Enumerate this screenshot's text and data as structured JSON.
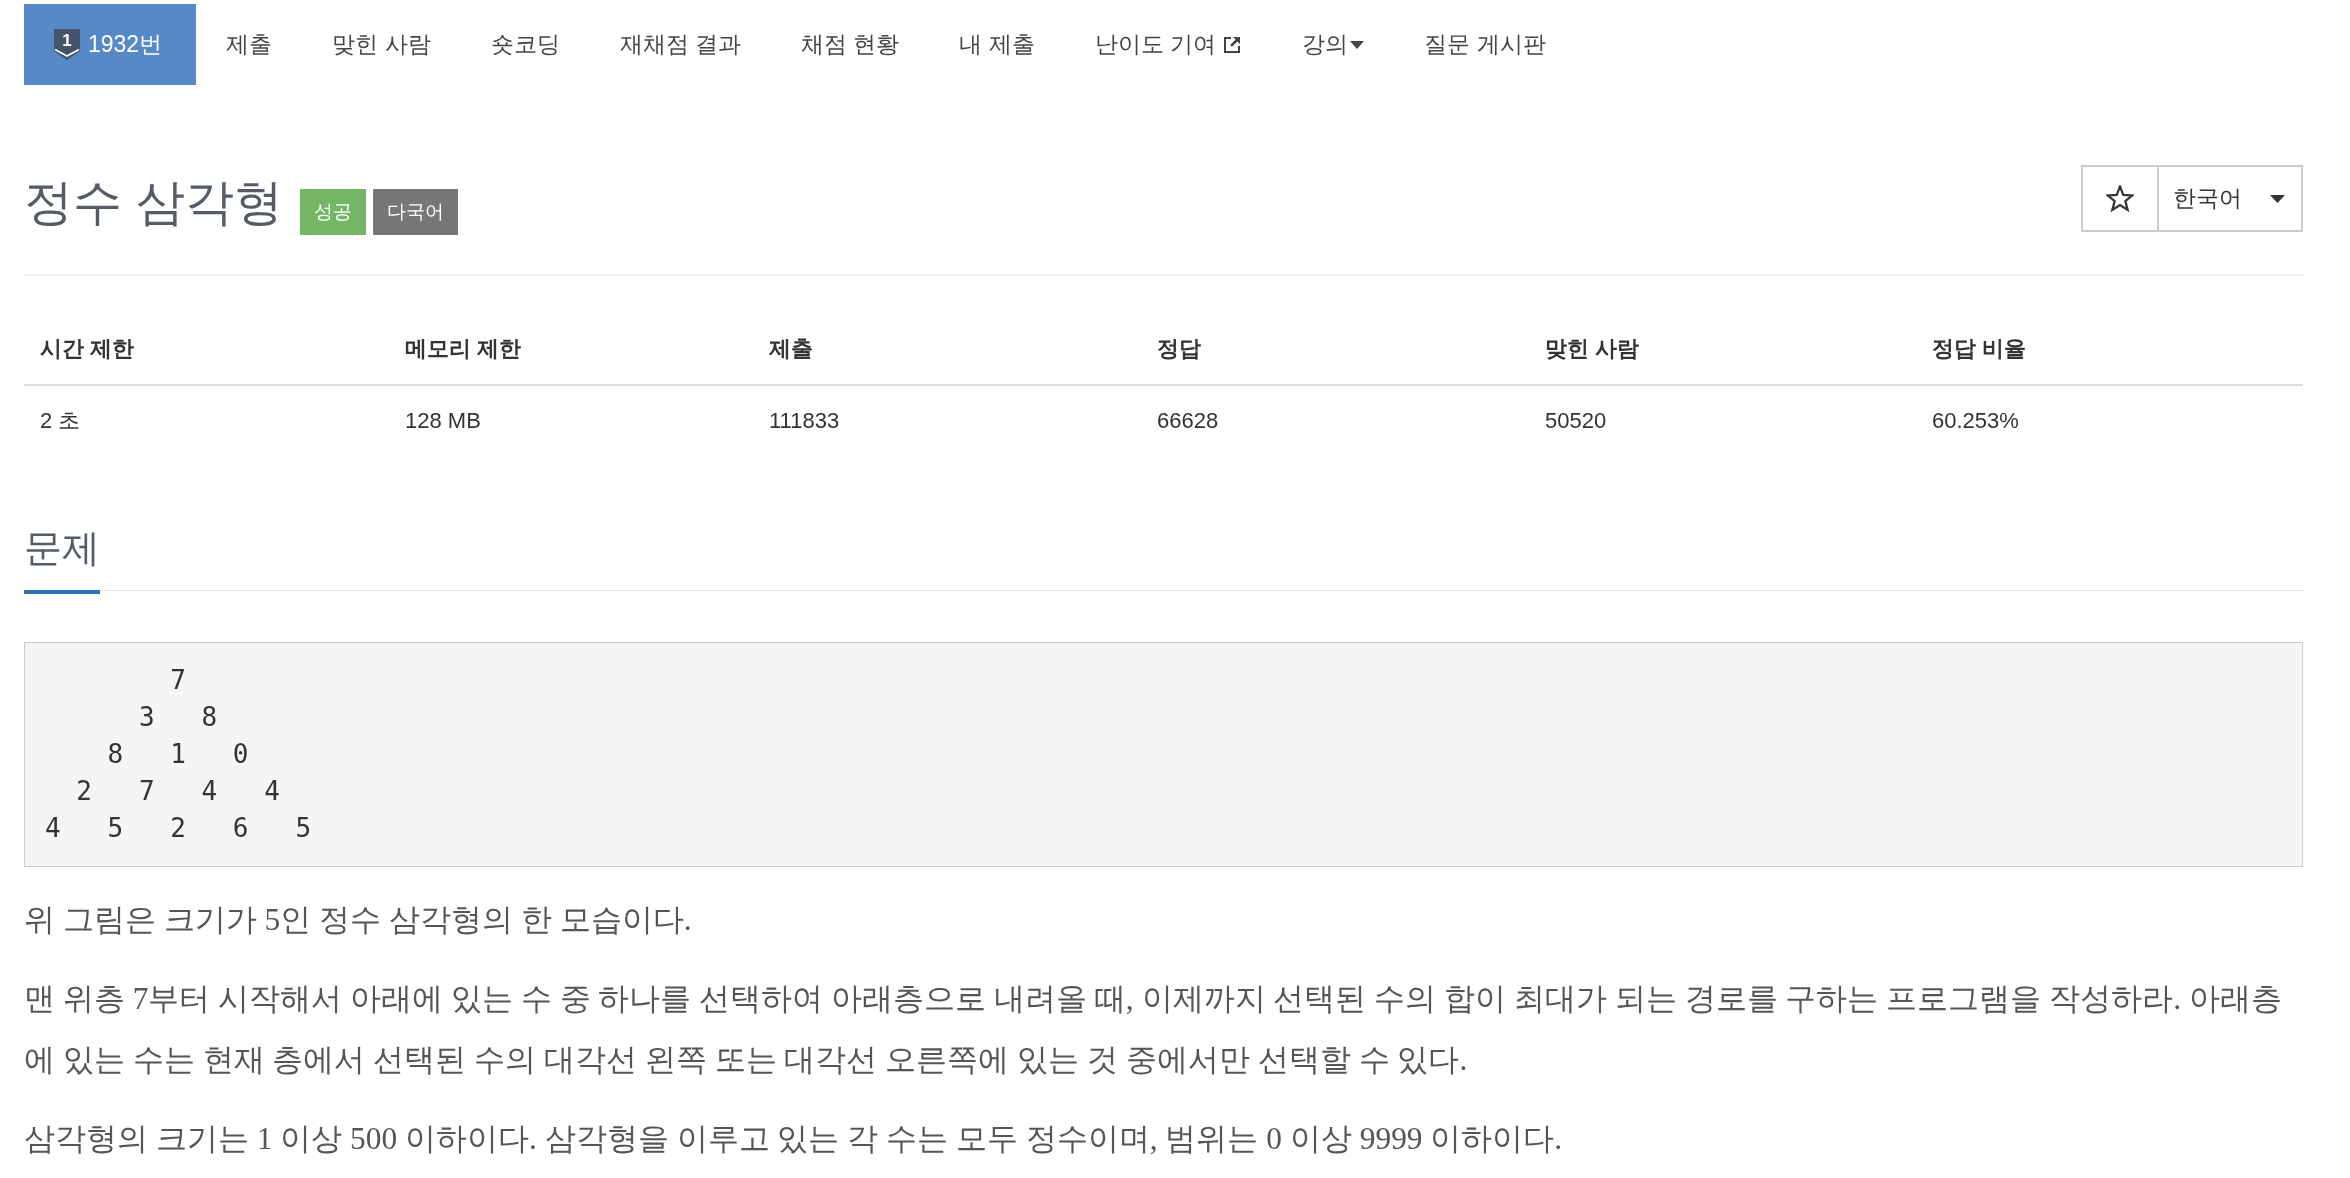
{
  "nav": {
    "items": [
      {
        "label": "1932번",
        "kind": "problem",
        "badge": "1",
        "selected": true
      },
      {
        "label": "제출",
        "kind": "link",
        "selected": false
      },
      {
        "label": "맞힌 사람",
        "kind": "link",
        "selected": false
      },
      {
        "label": "숏코딩",
        "kind": "link",
        "selected": false
      },
      {
        "label": "재채점 결과",
        "kind": "link",
        "selected": false
      },
      {
        "label": "채점 현황",
        "kind": "link",
        "selected": false
      },
      {
        "label": "내 제출",
        "kind": "link",
        "selected": false
      },
      {
        "label": "난이도 기여",
        "kind": "external",
        "selected": false
      },
      {
        "label": "강의",
        "kind": "dropdown",
        "selected": false
      },
      {
        "label": "질문 게시판",
        "kind": "link",
        "selected": false
      }
    ]
  },
  "problem": {
    "title": "정수 삼각형",
    "tags": [
      {
        "label": "성공",
        "color": "#74b566"
      },
      {
        "label": "다국어",
        "color": "#777777"
      }
    ],
    "favorite": {
      "starred": false
    },
    "language_select": {
      "value": "한국어"
    }
  },
  "limits_table": {
    "columns": [
      "시간 제한",
      "메모리 제한",
      "제출",
      "정답",
      "맞힌 사람",
      "정답 비율"
    ],
    "rows": [
      [
        "2 초",
        "128 MB",
        "111833",
        "66628",
        "50520",
        "60.253%"
      ]
    ]
  },
  "statement": {
    "heading": "문제",
    "figure_text": "        7\n      3   8\n    8   1   0\n  2   7   4   4\n4   5   2   6   5",
    "paragraphs": [
      "위 그림은 크기가 5인 정수 삼각형의 한 모습이다.",
      "맨 위층 7부터 시작해서 아래에 있는 수 중 하나를 선택하여 아래층으로 내려올 때, 이제까지 선택된 수의 합이 최대가 되는 경로를 구하는 프로그램을 작성하라. 아래층에 있는 수는 현재 층에서 선택된 수의 대각선 왼쪽 또는 대각선 오른쪽에 있는 것 중에서만 선택할 수 있다.",
      "삼각형의 크기는 1 이상 500 이하이다. 삼각형을 이루고 있는 각 수는 모두 정수이며, 범위는 0 이상 9999 이하이다."
    ]
  }
}
